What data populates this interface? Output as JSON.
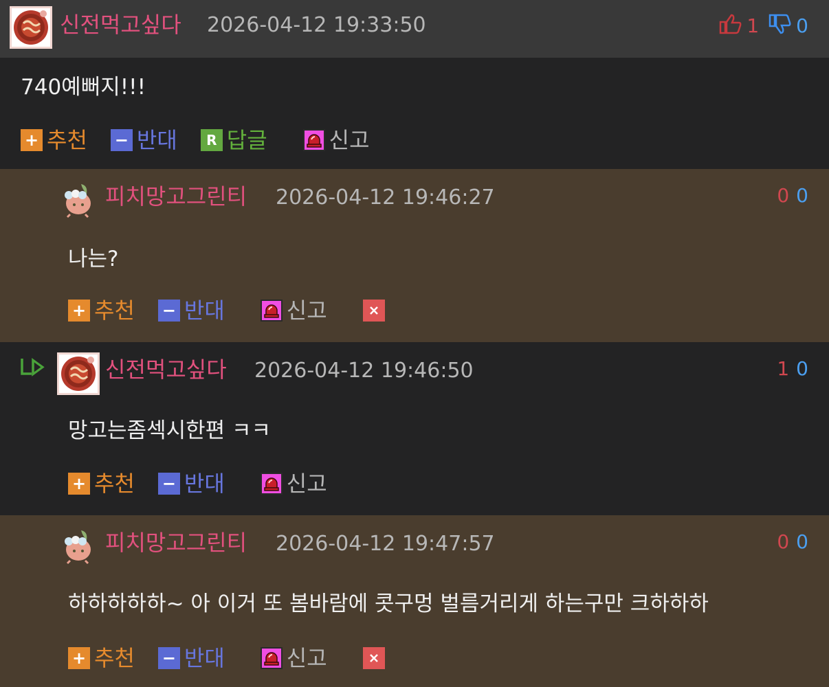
{
  "actions": {
    "recommend": "추천",
    "oppose": "반대",
    "reply": "답글",
    "report": "신고"
  },
  "comments": [
    {
      "nickname": "신전먹고싶다",
      "datetime": "2026-04-12 19:33:50",
      "upvotes": "1",
      "downvotes": "0",
      "text": "740예뻐지!!!"
    },
    {
      "nickname": "피치망고그린티",
      "datetime": "2026-04-12 19:46:27",
      "upvotes": "0",
      "downvotes": "0",
      "text": "나는?"
    },
    {
      "nickname": "신전먹고싶다",
      "datetime": "2026-04-12 19:46:50",
      "upvotes": "1",
      "downvotes": "0",
      "text": "망고는좀섹시한편 ㅋㅋ"
    },
    {
      "nickname": "피치망고그린티",
      "datetime": "2026-04-12 19:47:57",
      "upvotes": "0",
      "downvotes": "0",
      "text": "하하하하하~ 아 이거 또 봄바람에 콧구멍 벌름거리게 하는구만 크하하하"
    }
  ],
  "colors": {
    "nickname": "#e2517e",
    "upvote": "#d0474f",
    "downvote": "#4b9ff0",
    "recommend": "#e58a2d",
    "oppose": "#5b6ad4",
    "reply": "#63a840",
    "report": "#f04ee2",
    "delete": "#e05656",
    "reply_bg": "#4a3d2e"
  }
}
